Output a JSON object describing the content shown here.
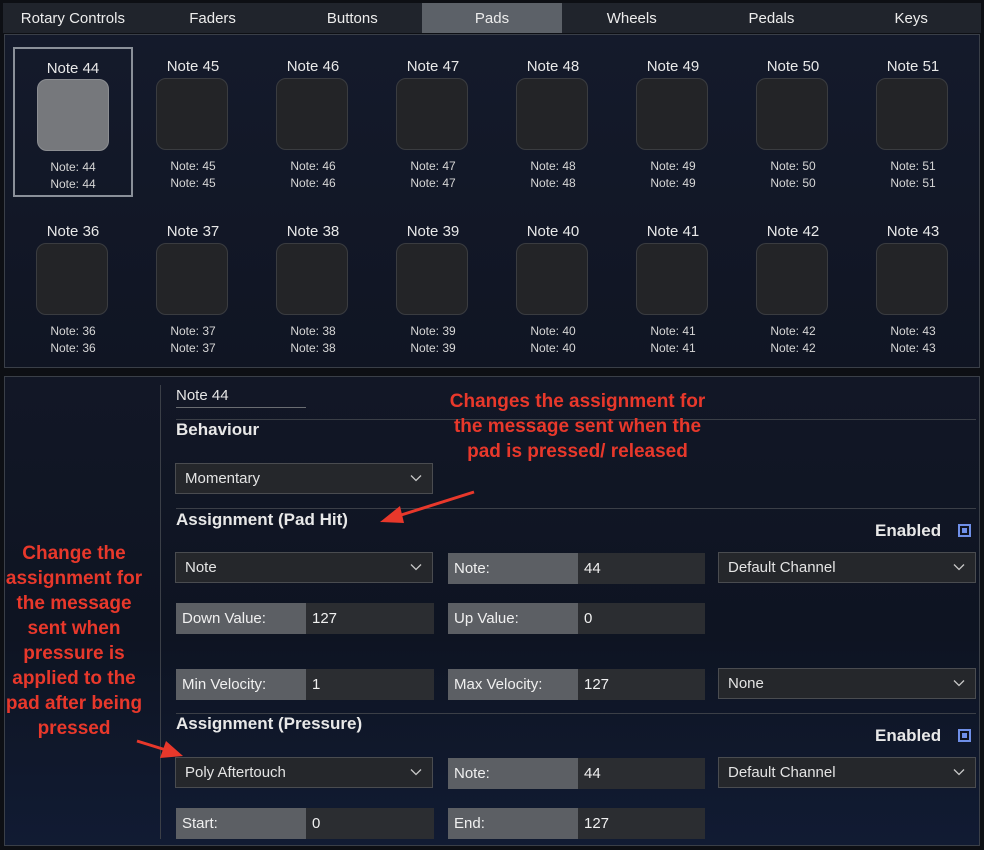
{
  "tabs": [
    "Rotary Controls",
    "Faders",
    "Buttons",
    "Pads",
    "Wheels",
    "Pedals",
    "Keys"
  ],
  "active_tab": "Pads",
  "pads": {
    "row1": [
      {
        "title": "Note 44",
        "line1": "Note: 44",
        "line2": "Note: 44",
        "selected": true
      },
      {
        "title": "Note 45",
        "line1": "Note: 45",
        "line2": "Note: 45"
      },
      {
        "title": "Note 46",
        "line1": "Note: 46",
        "line2": "Note: 46"
      },
      {
        "title": "Note 47",
        "line1": "Note: 47",
        "line2": "Note: 47"
      },
      {
        "title": "Note 48",
        "line1": "Note: 48",
        "line2": "Note: 48"
      },
      {
        "title": "Note 49",
        "line1": "Note: 49",
        "line2": "Note: 49"
      },
      {
        "title": "Note 50",
        "line1": "Note: 50",
        "line2": "Note: 50"
      },
      {
        "title": "Note 51",
        "line1": "Note: 51",
        "line2": "Note: 51"
      }
    ],
    "row2": [
      {
        "title": "Note 36",
        "line1": "Note: 36",
        "line2": "Note: 36"
      },
      {
        "title": "Note 37",
        "line1": "Note: 37",
        "line2": "Note: 37"
      },
      {
        "title": "Note 38",
        "line1": "Note: 38",
        "line2": "Note: 38"
      },
      {
        "title": "Note 39",
        "line1": "Note: 39",
        "line2": "Note: 39"
      },
      {
        "title": "Note 40",
        "line1": "Note: 40",
        "line2": "Note: 40"
      },
      {
        "title": "Note 41",
        "line1": "Note: 41",
        "line2": "Note: 41"
      },
      {
        "title": "Note 42",
        "line1": "Note: 42",
        "line2": "Note: 42"
      },
      {
        "title": "Note 43",
        "line1": "Note: 43",
        "line2": "Note: 43"
      }
    ]
  },
  "editor": {
    "name": "Note 44",
    "behaviour_heading": "Behaviour",
    "behaviour_value": "Momentary",
    "pad_hit": {
      "heading": "Assignment (Pad Hit)",
      "enabled_label": "Enabled",
      "type_value": "Note",
      "note_label": "Note:",
      "note_value": "44",
      "channel_value": "Default Channel",
      "down_label": "Down Value:",
      "down_value": "127",
      "up_label": "Up Value:",
      "up_value": "0",
      "min_vel_label": "Min Velocity:",
      "min_vel_value": "1",
      "max_vel_label": "Max Velocity:",
      "max_vel_value": "127",
      "curve_value": "None"
    },
    "pressure": {
      "heading": "Assignment (Pressure)",
      "enabled_label": "Enabled",
      "type_value": "Poly Aftertouch",
      "note_label": "Note:",
      "note_value": "44",
      "channel_value": "Default Channel",
      "start_label": "Start:",
      "start_value": "0",
      "end_label": "End:",
      "end_value": "127"
    }
  },
  "annotations": {
    "pad_hit_note": "Changes the assignment for the message sent when the pad is pressed/ released",
    "pressure_note": "Change the assignment for the message sent when pressure is applied to the pad after being pressed"
  },
  "colors": {
    "annotation": "#e8382b",
    "checkbox": "#6f8fe8",
    "active_tab": "#5c6168"
  }
}
